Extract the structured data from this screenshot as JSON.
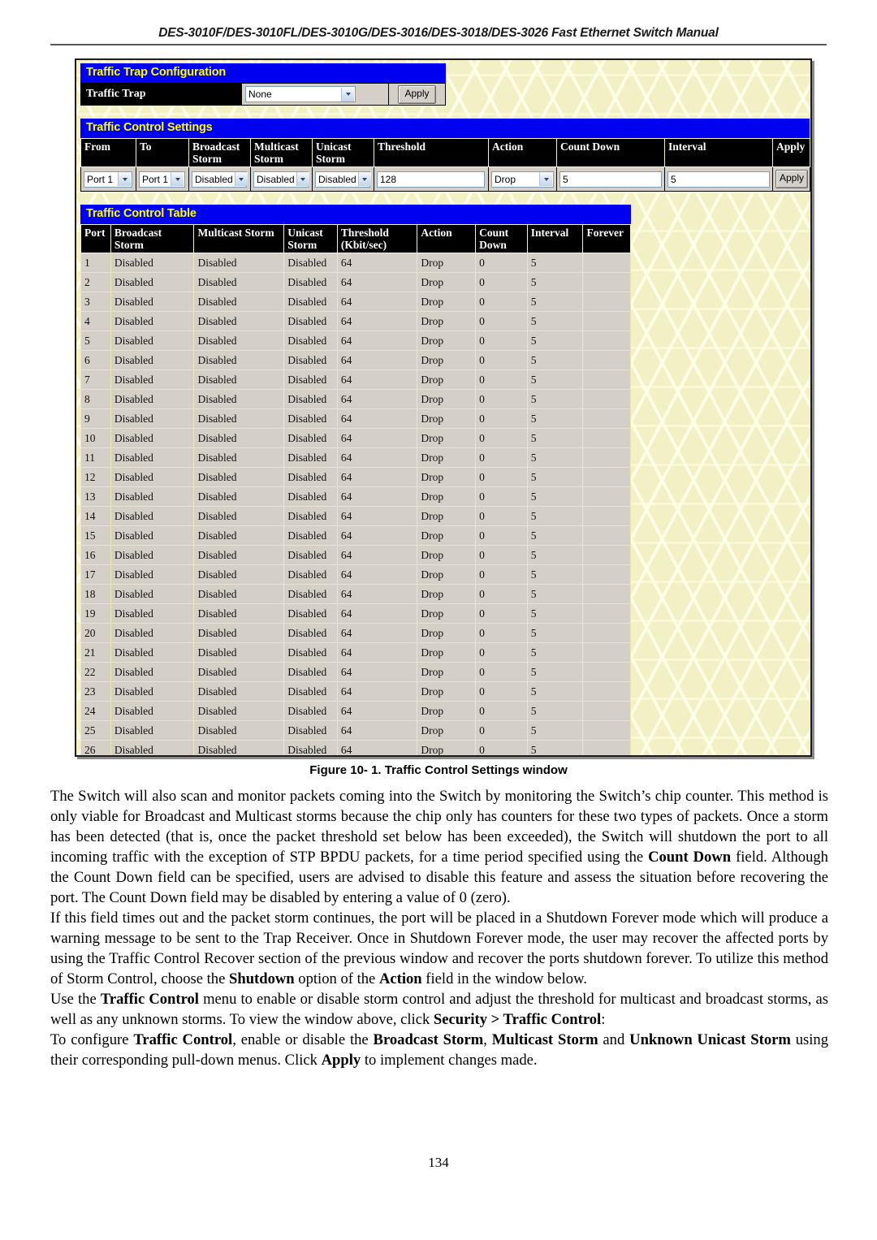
{
  "header": {
    "running_head": "DES-3010F/DES-3010FL/DES-3010G/DES-3016/DES-3018/DES-3026 Fast Ethernet Switch Manual"
  },
  "figure": {
    "caption": "Figure 10- 1. Traffic Control Settings window",
    "traffic_trap": {
      "panel_title": "Traffic Trap Configuration",
      "row_label": "Traffic Trap",
      "select_value": "None",
      "apply_label": "Apply"
    },
    "traffic_control_settings": {
      "panel_title": "Traffic Control Settings",
      "columns": [
        "From",
        "To",
        "Broadcast Storm",
        "Multicast Storm",
        "Unicast Storm",
        "Threshold",
        "Action",
        "Count Down",
        "Interval",
        "Apply"
      ],
      "values": {
        "from": "Port 1",
        "to": "Port 1",
        "broadcast_storm": "Disabled",
        "multicast_storm": "Disabled",
        "unicast_storm": "Disabled",
        "threshold": "128",
        "action": "Drop",
        "count_down": "5",
        "interval": "5",
        "apply_label": "Apply"
      }
    },
    "traffic_control_table": {
      "panel_title": "Traffic Control Table",
      "columns": [
        "Port",
        "Broadcast Storm",
        "Multicast Storm",
        "Unicast Storm",
        "Threshold (Kbit/sec)",
        "Action",
        "Count Down",
        "Interval",
        "Forever"
      ],
      "rows": [
        [
          "1",
          "Disabled",
          "Disabled",
          "Disabled",
          "64",
          "Drop",
          "0",
          "5",
          ""
        ],
        [
          "2",
          "Disabled",
          "Disabled",
          "Disabled",
          "64",
          "Drop",
          "0",
          "5",
          ""
        ],
        [
          "3",
          "Disabled",
          "Disabled",
          "Disabled",
          "64",
          "Drop",
          "0",
          "5",
          ""
        ],
        [
          "4",
          "Disabled",
          "Disabled",
          "Disabled",
          "64",
          "Drop",
          "0",
          "5",
          ""
        ],
        [
          "5",
          "Disabled",
          "Disabled",
          "Disabled",
          "64",
          "Drop",
          "0",
          "5",
          ""
        ],
        [
          "6",
          "Disabled",
          "Disabled",
          "Disabled",
          "64",
          "Drop",
          "0",
          "5",
          ""
        ],
        [
          "7",
          "Disabled",
          "Disabled",
          "Disabled",
          "64",
          "Drop",
          "0",
          "5",
          ""
        ],
        [
          "8",
          "Disabled",
          "Disabled",
          "Disabled",
          "64",
          "Drop",
          "0",
          "5",
          ""
        ],
        [
          "9",
          "Disabled",
          "Disabled",
          "Disabled",
          "64",
          "Drop",
          "0",
          "5",
          ""
        ],
        [
          "10",
          "Disabled",
          "Disabled",
          "Disabled",
          "64",
          "Drop",
          "0",
          "5",
          ""
        ],
        [
          "11",
          "Disabled",
          "Disabled",
          "Disabled",
          "64",
          "Drop",
          "0",
          "5",
          ""
        ],
        [
          "12",
          "Disabled",
          "Disabled",
          "Disabled",
          "64",
          "Drop",
          "0",
          "5",
          ""
        ],
        [
          "13",
          "Disabled",
          "Disabled",
          "Disabled",
          "64",
          "Drop",
          "0",
          "5",
          ""
        ],
        [
          "14",
          "Disabled",
          "Disabled",
          "Disabled",
          "64",
          "Drop",
          "0",
          "5",
          ""
        ],
        [
          "15",
          "Disabled",
          "Disabled",
          "Disabled",
          "64",
          "Drop",
          "0",
          "5",
          ""
        ],
        [
          "16",
          "Disabled",
          "Disabled",
          "Disabled",
          "64",
          "Drop",
          "0",
          "5",
          ""
        ],
        [
          "17",
          "Disabled",
          "Disabled",
          "Disabled",
          "64",
          "Drop",
          "0",
          "5",
          ""
        ],
        [
          "18",
          "Disabled",
          "Disabled",
          "Disabled",
          "64",
          "Drop",
          "0",
          "5",
          ""
        ],
        [
          "19",
          "Disabled",
          "Disabled",
          "Disabled",
          "64",
          "Drop",
          "0",
          "5",
          ""
        ],
        [
          "20",
          "Disabled",
          "Disabled",
          "Disabled",
          "64",
          "Drop",
          "0",
          "5",
          ""
        ],
        [
          "21",
          "Disabled",
          "Disabled",
          "Disabled",
          "64",
          "Drop",
          "0",
          "5",
          ""
        ],
        [
          "22",
          "Disabled",
          "Disabled",
          "Disabled",
          "64",
          "Drop",
          "0",
          "5",
          ""
        ],
        [
          "23",
          "Disabled",
          "Disabled",
          "Disabled",
          "64",
          "Drop",
          "0",
          "5",
          ""
        ],
        [
          "24",
          "Disabled",
          "Disabled",
          "Disabled",
          "64",
          "Drop",
          "0",
          "5",
          ""
        ],
        [
          "25",
          "Disabled",
          "Disabled",
          "Disabled",
          "64",
          "Drop",
          "0",
          "5",
          ""
        ],
        [
          "26",
          "Disabled",
          "Disabled",
          "Disabled",
          "64",
          "Drop",
          "0",
          "5",
          ""
        ]
      ]
    }
  },
  "body": {
    "paragraphs": [
      [
        {
          "t": "The Switch will also scan and monitor packets coming into the Switch by monitoring the Switch’s chip counter. This method is only viable for Broadcast and Multicast storms because the chip only has counters for these two types of packets. Once a storm has been detected (that is, once the packet threshold set below has been exceeded), the Switch will shutdown the port to all incoming traffic with the exception of STP BPDU packets, for a time period specified using the ",
          "b": false
        },
        {
          "t": "Count Down",
          "b": true
        },
        {
          "t": " field. Although the Count Down field can be specified, users are advised to disable this feature and assess the situation before recovering the port. The Count Down field may be disabled by entering a value of 0 (zero).",
          "b": false
        }
      ],
      [
        {
          "t": "If this field times out and the packet storm continues, the port will be placed in a Shutdown Forever mode which will produce a warning message to be sent to the Trap Receiver. Once in Shutdown Forever mode, the user may recover the affected ports by using the Traffic Control Recover section of the previous window and recover the ports shutdown forever. To utilize this method of Storm Control, choose the ",
          "b": false
        },
        {
          "t": "Shutdown",
          "b": true
        },
        {
          "t": " option of the ",
          "b": false
        },
        {
          "t": "Action",
          "b": true
        },
        {
          "t": " field in the window below.",
          "b": false
        }
      ],
      [
        {
          "t": "Use the ",
          "b": false
        },
        {
          "t": "Traffic Control",
          "b": true
        },
        {
          "t": " menu to enable or disable storm control and adjust the threshold for multicast and broadcast storms, as well as any unknown storms. To view the window above, click ",
          "b": false
        },
        {
          "t": "Security > Traffic Control",
          "b": true
        },
        {
          "t": ":",
          "b": false
        }
      ],
      [
        {
          "t": "To configure ",
          "b": false
        },
        {
          "t": "Traffic Control",
          "b": true
        },
        {
          "t": ", enable or disable the ",
          "b": false
        },
        {
          "t": "Broadcast Storm",
          "b": true
        },
        {
          "t": ", ",
          "b": false
        },
        {
          "t": "Multicast Storm",
          "b": true
        },
        {
          "t": " and ",
          "b": false
        },
        {
          "t": "Unknown Unicast Storm",
          "b": true
        },
        {
          "t": " using their corresponding pull-down menus. Click ",
          "b": false
        },
        {
          "t": "Apply",
          "b": true
        },
        {
          "t": " to implement changes made.",
          "b": false
        }
      ]
    ]
  },
  "footer": {
    "page_number": "134"
  },
  "colors": {
    "panel_title_bg": "#0000f0",
    "panel_title_fg": "#ffff00",
    "table_header_bg": "#000000",
    "row_bg": "#d4d0c8",
    "window_bg": "#f2f0c4"
  }
}
